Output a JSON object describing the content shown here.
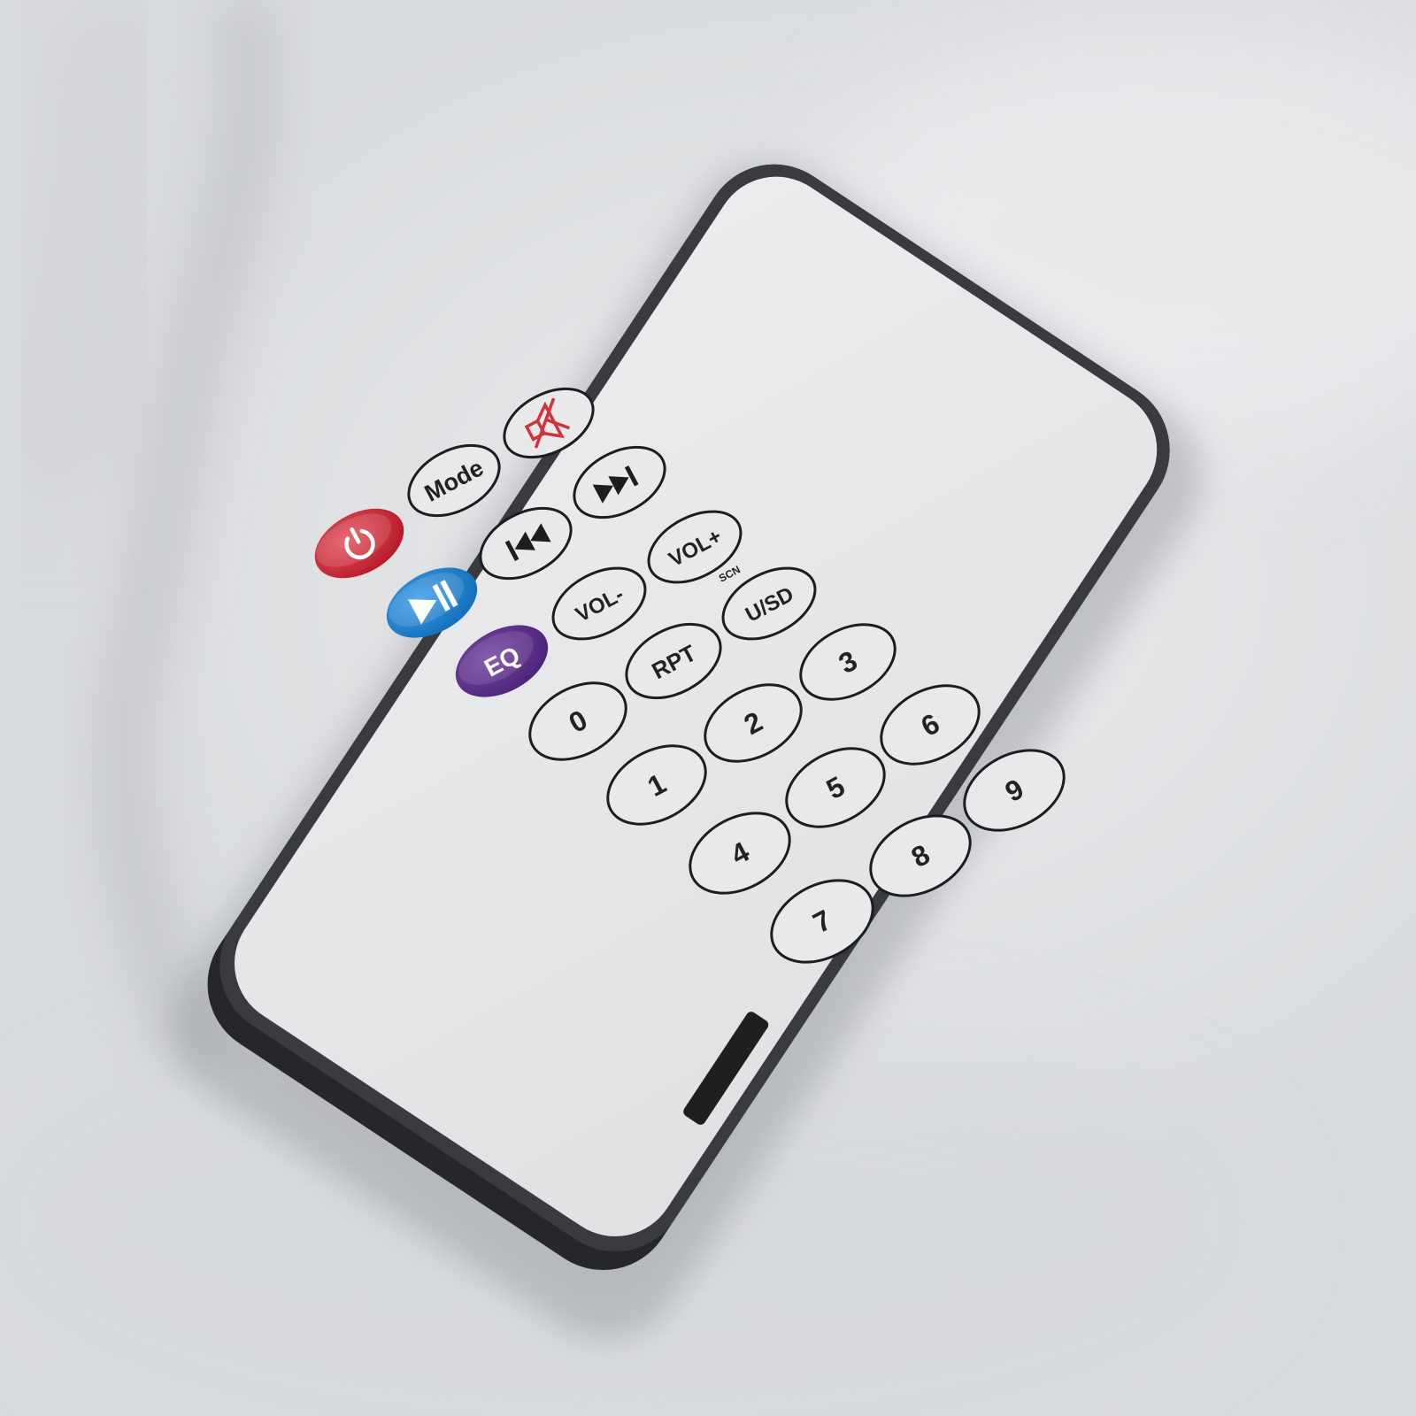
{
  "remote": {
    "colors": {
      "body": "#2a2b2d",
      "panel": "#e4e6e8",
      "power_button": "#c7202e",
      "play_button": "#1b7fd0",
      "eq_button": "#5a2e86",
      "mute_icon": "#d2333a"
    },
    "icons": {
      "power": "power-icon",
      "mute": "mute-icon",
      "next": "next-track-icon",
      "prev": "previous-track-icon",
      "play_pause": "play-pause-icon"
    },
    "labels": {
      "mode": "Mode",
      "vol_plus": "VOL+",
      "vol_minus": "VOL-",
      "usd": "U/SD",
      "scn": "SCN",
      "eq": "EQ",
      "rpt": "RPT",
      "n0": "0",
      "n1": "1",
      "n2": "2",
      "n3": "3",
      "n4": "4",
      "n5": "5",
      "n6": "6",
      "n7": "7",
      "n8": "8",
      "n9": "9"
    }
  }
}
